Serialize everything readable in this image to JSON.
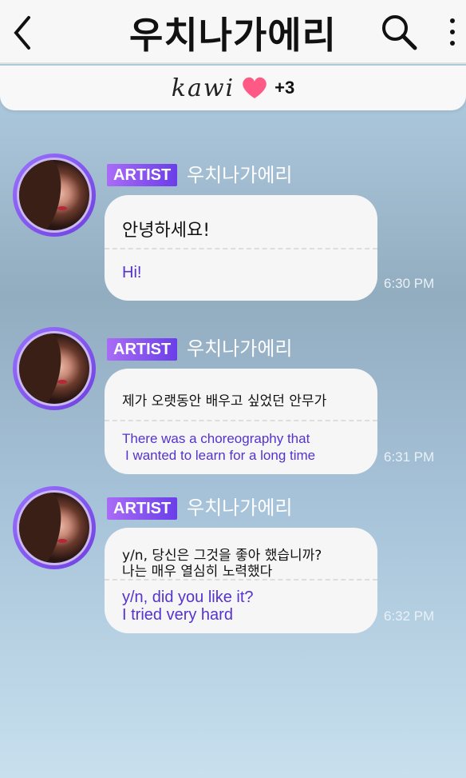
{
  "header": {
    "title": "우치나가에리",
    "back_icon": "chevron-left-icon",
    "search_icon": "search-icon",
    "more_icon": "more-vertical-icon"
  },
  "subbar": {
    "name": "kawi",
    "heart_icon": "heart-icon",
    "heart_color": "#ff5a86",
    "extra_count": "+3"
  },
  "messages": [
    {
      "badge": "ARTIST",
      "sender": "우치나가에리",
      "korean": "안녕하세요!",
      "english": "Hi!",
      "time": "6:30 PM"
    },
    {
      "badge": "ARTIST",
      "sender": "우치나가에리",
      "korean": "제가 오랫동안 배우고 싶었던 안무가",
      "english_lines": [
        "There was a choreography that",
        "I wanted to learn for a long time"
      ],
      "time": "6:31 PM"
    },
    {
      "badge": "ARTIST",
      "sender": "우치나가에리",
      "korean_lines": [
        "y/n, 당신은 그것을 좋아 했습니까?",
        "나는 매우 열심히 노력했다"
      ],
      "english_lines": [
        "y/n, did you like it?",
        "I tried very hard"
      ],
      "time": "6:32 PM"
    }
  ],
  "colors": {
    "badge_gradient_start": "#a96cf6",
    "badge_gradient_end": "#6a3ee8",
    "translation_text": "#5533cc"
  }
}
